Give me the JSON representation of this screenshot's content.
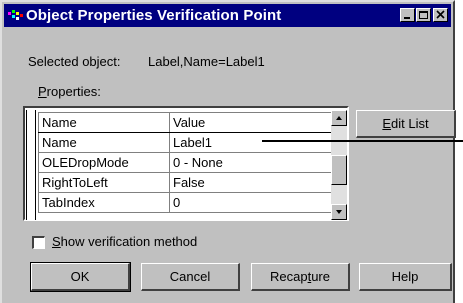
{
  "window": {
    "title": "Object Properties Verification Point",
    "controls": {
      "minimize": "_",
      "maximize": "□",
      "close": "×"
    }
  },
  "selected_object": {
    "label": "Selected object:",
    "value": "Label,Name=Label1"
  },
  "properties": {
    "label_prefix": "",
    "label_mnemonic": "P",
    "label_rest": "roperties:",
    "columns": [
      "Name",
      "Value"
    ],
    "rows": [
      {
        "name": "Name",
        "value": "Label1"
      },
      {
        "name": "OLEDropMode",
        "value": "0 - None"
      },
      {
        "name": "RightToLeft",
        "value": "False"
      },
      {
        "name": "TabIndex",
        "value": "0"
      }
    ]
  },
  "edit_list_button": {
    "mnemonic": "E",
    "rest": "dit List"
  },
  "verification_checkbox": {
    "mnemonic": "S",
    "rest": "how verification method",
    "checked": false
  },
  "buttons": {
    "ok": "OK",
    "cancel": "Cancel",
    "recapture_prefix": "Recap",
    "recapture_mnemonic": "t",
    "recapture_suffix": "ure",
    "help": "Help"
  },
  "icons": {
    "title_icon": "rational-app-icon",
    "scroll_up": "arrow-up-icon",
    "scroll_down": "arrow-down-icon"
  }
}
